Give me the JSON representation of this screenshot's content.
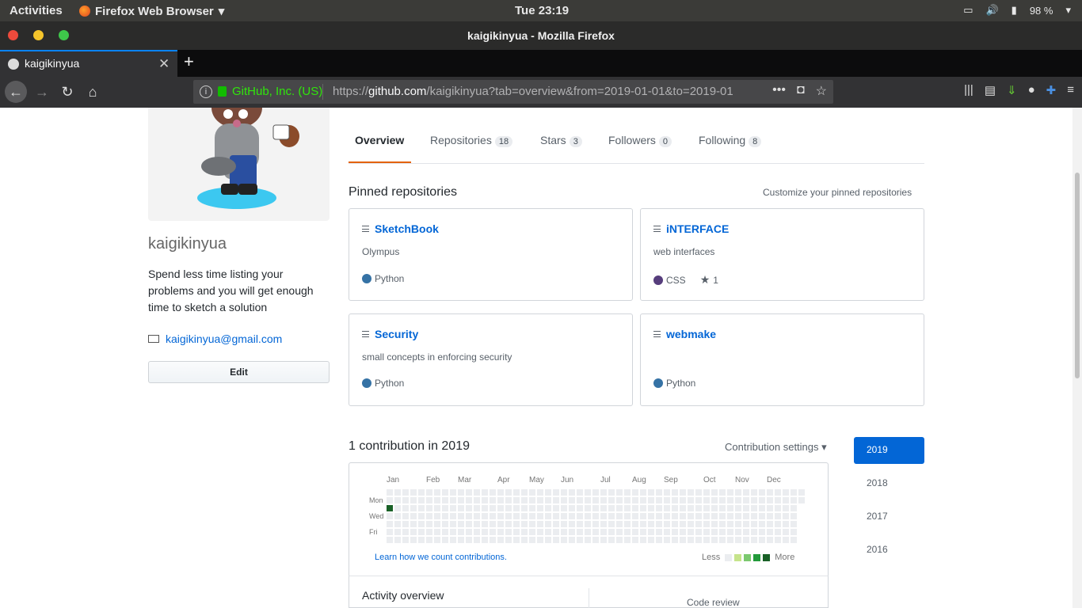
{
  "system": {
    "activities": "Activities",
    "app_name": "Firefox Web Browser",
    "clock": "Tue 23:19",
    "battery": "98 %"
  },
  "window": {
    "title": "kaigikinyua - Mozilla Firefox"
  },
  "tab": {
    "title": "kaigikinyua"
  },
  "urlbar": {
    "org": "GitHub, Inc. (US)",
    "url_prefix": "https://",
    "url_domain": "github.com",
    "url_rest": "/kaigikinyua?tab=overview&from=2019-01-01&to=2019-01"
  },
  "profile": {
    "username": "kaigikinyua",
    "bio": "Spend less time listing your problems and you will get enough time to sketch a solution",
    "email": "kaigikinyua@gmail.com",
    "edit_label": "Edit"
  },
  "profile_tabs": [
    {
      "label": "Overview",
      "count": null
    },
    {
      "label": "Repositories",
      "count": "18"
    },
    {
      "label": "Stars",
      "count": "3"
    },
    {
      "label": "Followers",
      "count": "0"
    },
    {
      "label": "Following",
      "count": "8"
    }
  ],
  "pinned": {
    "heading": "Pinned repositories",
    "customize": "Customize your pinned repositories",
    "repos": [
      {
        "name": "SketchBook",
        "desc": "Olympus",
        "lang": "Python",
        "lang_color": "#3572A5",
        "stars": ""
      },
      {
        "name": "iNTERFACE",
        "desc": "web interfaces",
        "lang": "CSS",
        "lang_color": "#563d7c",
        "stars": "1"
      },
      {
        "name": "Security",
        "desc": "small concepts in enforcing security",
        "lang": "Python",
        "lang_color": "#3572A5",
        "stars": ""
      },
      {
        "name": "webmake",
        "desc": "",
        "lang": "Python",
        "lang_color": "#3572A5",
        "stars": ""
      }
    ]
  },
  "contributions": {
    "heading": "1 contribution in 2019",
    "settings": "Contribution settings",
    "months": [
      "Jan",
      "Feb",
      "Mar",
      "Apr",
      "May",
      "Jun",
      "Jul",
      "Aug",
      "Sep",
      "Oct",
      "Nov",
      "Dec"
    ],
    "day_labels": [
      "Mon",
      "Wed",
      "Fri"
    ],
    "learn": "Learn how we count contributions.",
    "less": "Less",
    "more": "More",
    "legend_colors": [
      "#ebedf0",
      "#c6e48b",
      "#7bc96f",
      "#239a3b",
      "#196127"
    ],
    "active_color": "#196127"
  },
  "activity": {
    "title": "Activity overview",
    "code_review": "Code review"
  },
  "years": [
    "2019",
    "2018",
    "2017",
    "2016"
  ]
}
